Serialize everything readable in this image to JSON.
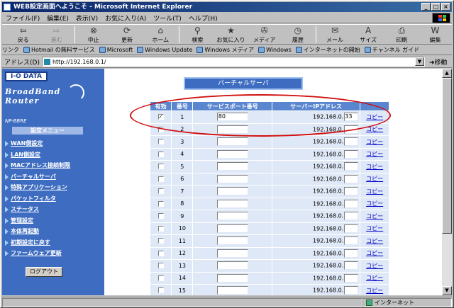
{
  "window": {
    "title": "WEB設定画面へようこそ - Microsoft Internet Explorer",
    "min": "_",
    "max": "□",
    "close": "×"
  },
  "menubar": [
    "ファイル(F)",
    "編集(E)",
    "表示(V)",
    "お気に入り(A)",
    "ツール(T)",
    "ヘルプ(H)"
  ],
  "toolbar": [
    {
      "label": "戻る",
      "icon": "back-arrow-icon",
      "glyph": "⇦",
      "enabled": true
    },
    {
      "label": "進む",
      "icon": "forward-arrow-icon",
      "glyph": "⇨",
      "enabled": false
    },
    {
      "label": "中止",
      "icon": "stop-icon",
      "glyph": "⊗",
      "enabled": true
    },
    {
      "label": "更新",
      "icon": "refresh-icon",
      "glyph": "⟳",
      "enabled": true
    },
    {
      "label": "ホーム",
      "icon": "home-icon",
      "glyph": "⌂",
      "enabled": true
    },
    {
      "label": "検索",
      "icon": "search-icon",
      "glyph": "⚲",
      "enabled": true
    },
    {
      "label": "お気に入り",
      "icon": "favorites-icon",
      "glyph": "★",
      "enabled": true
    },
    {
      "label": "メディア",
      "icon": "media-icon",
      "glyph": "✇",
      "enabled": true
    },
    {
      "label": "履歴",
      "icon": "history-icon",
      "glyph": "◷",
      "enabled": true
    },
    {
      "label": "メール",
      "icon": "mail-icon",
      "glyph": "✉",
      "enabled": true
    },
    {
      "label": "サイズ",
      "icon": "font-size-icon",
      "glyph": "A",
      "enabled": true
    },
    {
      "label": "印刷",
      "icon": "print-icon",
      "glyph": "⎙",
      "enabled": true
    },
    {
      "label": "編集",
      "icon": "edit-icon",
      "glyph": "W",
      "enabled": true
    }
  ],
  "links": {
    "label": "リンク",
    "items": [
      "Hotmail の無料サービス",
      "Microsoft",
      "Windows Update",
      "Windows メディア",
      "Windows",
      "インターネットの開始",
      "チャンネル ガイド"
    ]
  },
  "address": {
    "label": "アドレス(D)",
    "url": "http://192.168.0.1/",
    "go": "移動"
  },
  "sidebar": {
    "logo": "I-O DATA",
    "brand_line1": "BroadBand",
    "brand_line2": "Router",
    "model": "NP-BBRE",
    "menu_title": "設定メニュー",
    "items": [
      "WAN側設定",
      "LAN側設定",
      "MACアドレス接続制限",
      "バーチャルサーバ",
      "特殊アプリケーション",
      "パケットフィルタ",
      "ステータス",
      "管理設定",
      "本体再起動",
      "初期設定に戻す",
      "ファームウェア更新"
    ],
    "logout": "ログアウト"
  },
  "page": {
    "title": "バーチャルサーバ",
    "headers": [
      "有効",
      "番号",
      "サービスポート番号",
      "サーバーIPアドレス",
      ""
    ],
    "ip_prefix": "192.168.0.",
    "copy_label": "コピー",
    "rows": [
      {
        "no": "1",
        "enabled": true,
        "port": "80",
        "ip": "33"
      },
      {
        "no": "2",
        "enabled": false,
        "port": "",
        "ip": ""
      },
      {
        "no": "3",
        "enabled": false,
        "port": "",
        "ip": ""
      },
      {
        "no": "4",
        "enabled": false,
        "port": "",
        "ip": ""
      },
      {
        "no": "5",
        "enabled": false,
        "port": "",
        "ip": ""
      },
      {
        "no": "6",
        "enabled": false,
        "port": "",
        "ip": ""
      },
      {
        "no": "7",
        "enabled": false,
        "port": "",
        "ip": ""
      },
      {
        "no": "8",
        "enabled": false,
        "port": "",
        "ip": ""
      },
      {
        "no": "9",
        "enabled": false,
        "port": "",
        "ip": ""
      },
      {
        "no": "10",
        "enabled": false,
        "port": "",
        "ip": ""
      },
      {
        "no": "11",
        "enabled": false,
        "port": "",
        "ip": ""
      },
      {
        "no": "12",
        "enabled": false,
        "port": "",
        "ip": ""
      },
      {
        "no": "13",
        "enabled": false,
        "port": "",
        "ip": ""
      },
      {
        "no": "14",
        "enabled": false,
        "port": "",
        "ip": ""
      },
      {
        "no": "15",
        "enabled": false,
        "port": "",
        "ip": ""
      }
    ]
  },
  "status": {
    "left": "",
    "zone": "インターネット"
  },
  "colors": {
    "sidebar": "#3d6cc0",
    "header": "#5a86d0",
    "cell": "#dfe8f6",
    "highlight": "#d01010"
  }
}
